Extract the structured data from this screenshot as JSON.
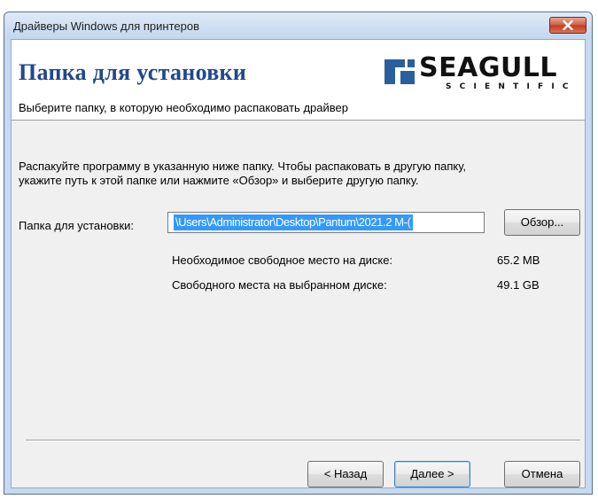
{
  "window": {
    "title": "Драйверы Windows для принтеров"
  },
  "header": {
    "title": "Папка для установки",
    "subtitle": "Выберите папку, в которую необходимо распаковать драйвер",
    "logo_name": "SEAGULL",
    "logo_sub": "SCIENTIFIC"
  },
  "body": {
    "description_line1": "Распакуйте программу в указанную ниже папку. Чтобы распаковать в другую папку,",
    "description_line2": "укажите путь к этой папке или нажмите «Обзор» и выберите  другую папку.",
    "folder_label": "Папка для установки:",
    "folder_value": "\\Users\\Administrator\\Desktop\\Pantum\\2021.2 M-(",
    "browse_label": "Обзор...",
    "required_space_label": "Необходимое свободное место на диске:",
    "required_space_value": "65.2 MB",
    "free_space_label": "Свободного места на выбранном диске:",
    "free_space_value": "49.1 GB"
  },
  "footer": {
    "back_label": "< Назад",
    "next_label": "Далее >",
    "cancel_label": "Отмена"
  },
  "colors": {
    "header_title": "#20488c",
    "selection": "#3399ff",
    "close_button": "#c74a2e",
    "logo_mark": "#2a5f9e"
  },
  "icons": {
    "close": "close-icon",
    "logo": "seagull-logo-icon"
  }
}
